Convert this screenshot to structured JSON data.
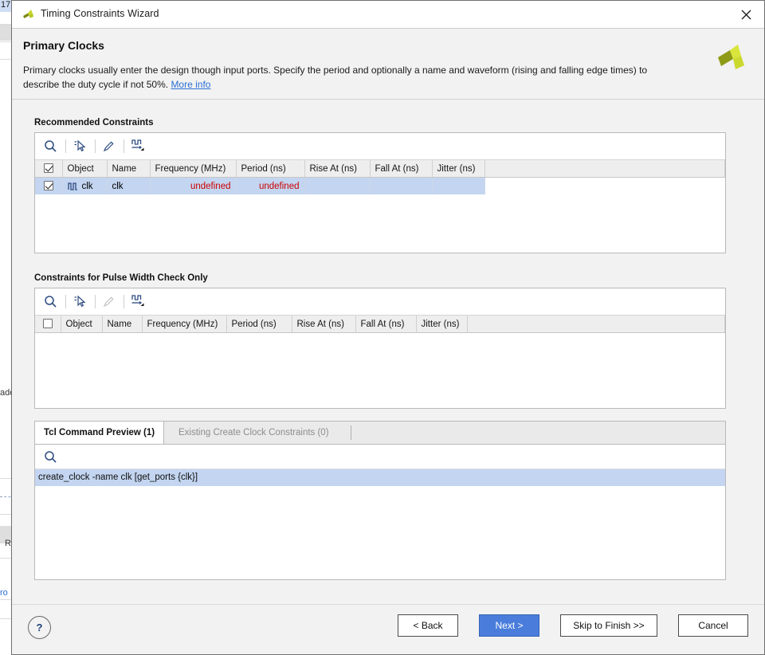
{
  "window": {
    "title": "Timing Constraints Wizard",
    "logo_icon": "vivado-logo-icon",
    "close_icon": "close-icon"
  },
  "header": {
    "title": "Primary Clocks",
    "description_part1": "Primary clocks usually enter the design though input ports. Specify the period and optionally a name and waveform (rising and falling edge times) to describe the duty cycle if not 50%. ",
    "more_info_link": "More info",
    "brand_logo_icon": "xilinx-logo-icon"
  },
  "recommended": {
    "label": "Recommended Constraints",
    "toolbar": [
      {
        "icon": "search-icon",
        "name": "search-button"
      },
      {
        "icon": "select-pointer-icon",
        "name": "select-button"
      },
      {
        "icon": "pencil-edit-icon",
        "name": "edit-button"
      },
      {
        "icon": "waveform-icon",
        "name": "waveform-button"
      }
    ],
    "columns": [
      "Object",
      "Name",
      "Frequency (MHz)",
      "Period (ns)",
      "Rise At (ns)",
      "Fall At (ns)",
      "Jitter (ns)"
    ],
    "header_checkbox_checked": true,
    "rows": [
      {
        "checked": true,
        "object_icon": "clock-waveform-icon",
        "object": "clk",
        "name": "clk",
        "frequency": "undefined",
        "period": "undefined",
        "rise_at": "",
        "fall_at": "",
        "jitter": "",
        "selected": true,
        "undefined_color": "#cc0000"
      }
    ]
  },
  "pulse_width": {
    "label": "Constraints for Pulse Width Check Only",
    "toolbar": [
      {
        "icon": "search-icon",
        "name": "search-button"
      },
      {
        "icon": "select-pointer-icon",
        "name": "select-button"
      },
      {
        "icon": "pencil-edit-icon",
        "name": "edit-button"
      },
      {
        "icon": "waveform-icon",
        "name": "waveform-button"
      }
    ],
    "columns": [
      "Object",
      "Name",
      "Frequency (MHz)",
      "Period (ns)",
      "Rise At (ns)",
      "Fall At (ns)",
      "Jitter (ns)"
    ],
    "header_checkbox_checked": false,
    "rows": []
  },
  "preview": {
    "tabs": [
      {
        "label": "Tcl Command Preview (1)",
        "active": true
      },
      {
        "label": "Existing Create Clock Constraints (0)",
        "active": false
      }
    ],
    "search_icon": "search-icon",
    "commands": [
      "create_clock -name clk [get_ports {clk}]"
    ]
  },
  "footer": {
    "help_label": "?",
    "buttons": [
      {
        "label": "< Back",
        "name": "back-button",
        "primary": false,
        "mnemonic": "B"
      },
      {
        "label": "Next >",
        "name": "next-button",
        "primary": true,
        "mnemonic": "N"
      },
      {
        "label": "Skip to Finish >>",
        "name": "skip-to-finish-button",
        "primary": false,
        "mnemonic": "S"
      },
      {
        "label": "Cancel",
        "name": "cancel-button",
        "primary": false,
        "mnemonic": ""
      }
    ]
  },
  "background": {
    "left_tab_text": "17",
    "left_texts": [
      "ado",
      "R",
      "ro"
    ],
    "colors": {
      "selection": "#c3d5f0",
      "accent": "#4a7ddb",
      "link": "#2a6fd6",
      "error": "#cc0000"
    }
  }
}
